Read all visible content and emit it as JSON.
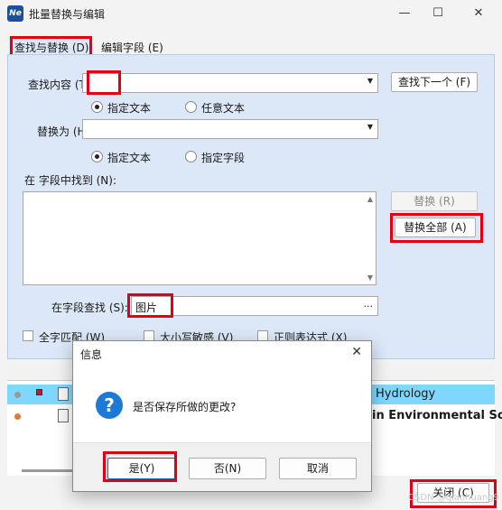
{
  "window": {
    "title": "批量替换与编辑",
    "app_icon_text": "Ne",
    "minimize": "—",
    "maximize": "☐",
    "close": "✕"
  },
  "tabs": [
    {
      "label": "查找与替换 (D)",
      "active": true
    },
    {
      "label": "编辑字段 (E)",
      "active": false
    }
  ],
  "find": {
    "label": "查找内容 (T):",
    "value": ":",
    "find_next_label": "查找下一个 (F)",
    "radio_options": [
      {
        "label": "指定文本",
        "checked": true
      },
      {
        "label": "任意文本",
        "checked": false
      }
    ]
  },
  "replace": {
    "label": "替换为 (H):",
    "value": "",
    "radio_options": [
      {
        "label": "指定文本",
        "checked": true
      },
      {
        "label": "指定字段",
        "checked": false
      }
    ]
  },
  "found_in": {
    "label": "在  字段中找到 (N):"
  },
  "buttons": {
    "replace": "替换 (R)",
    "replace_all": "替换全部 (A)",
    "close": "关闭 (C)"
  },
  "field_search": {
    "label": "在字段查找 (S):",
    "value": "图片",
    "browse": "..."
  },
  "options": [
    {
      "label": "全字匹配 (W)"
    },
    {
      "label": "大小写敏感 (V)"
    },
    {
      "label": "正则表达式 (X)"
    }
  ],
  "grid_rows": [
    {
      "text": "Hydrology",
      "selected": true
    },
    {
      "text": "in Environmental Sc",
      "selected": false
    }
  ],
  "dialog": {
    "title": "信息",
    "message": "是否保存所做的更改?",
    "yes": "是(Y)",
    "no": "否(N)",
    "cancel": "取消"
  },
  "watermark": "CSDN @qiaohuang9",
  "colors": {
    "highlight": "#e0000f",
    "panel": "#dce8f7",
    "selected_row": "#7fd7ff",
    "question_icon": "#1c79d6"
  }
}
